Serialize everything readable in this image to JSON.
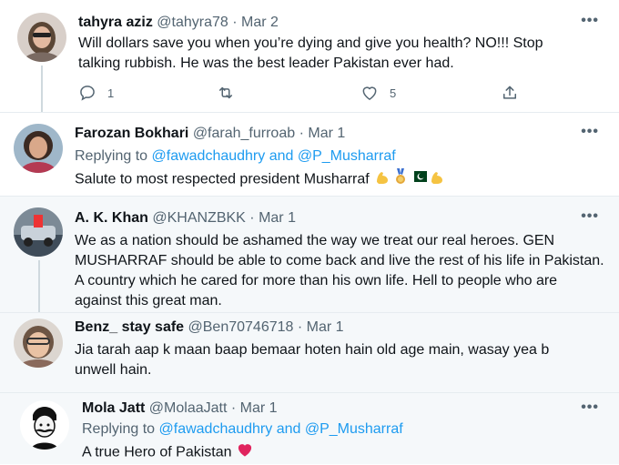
{
  "tweets": [
    {
      "name": "tahyra aziz",
      "handle": "@tahyra78",
      "date": "Mar 2",
      "text": "Will dollars save you when you’re dying and give you health? NO!!! Stop talking rubbish. He was the best leader Pakistan ever had.",
      "actions": {
        "reply_count": "1",
        "like_count": "5"
      }
    },
    {
      "name": "Farozan Bokhari",
      "handle": "@farah_furroab",
      "date": "Mar 1",
      "replying_prefix": "Replying to",
      "replying_to": "@fawadchaudhry and @P_Musharraf",
      "text": "Salute to most respected president Musharraf"
    },
    {
      "name": "A. K. Khan",
      "handle": "@KHANZBKK",
      "date": "Mar 1",
      "text": "We as a nation should be ashamed the way we treat our real heroes. GEN MUSHARRAF should be able to come back and live the rest of his life in Pakistan. A country which he cared for more than his own life. Hell to people who are against this great man."
    },
    {
      "name": "Benz_ stay safe",
      "handle": "@Ben70746718",
      "date": "Mar 1",
      "text": "Jia tarah aap k maan baap bemaar hoten hain old age main, wasay yea b unwell hain."
    },
    {
      "name": "Mola Jatt",
      "handle": "@MolaaJatt",
      "date": "Mar 1",
      "replying_prefix": "Replying to",
      "replying_to": "@fawadchaudhry and @P_Musharraf",
      "text": "A true Hero of Pakistan"
    }
  ],
  "ui": {
    "more": "•••",
    "dot": "·"
  },
  "colors": {
    "link": "#1d9bf0",
    "muted": "#536471",
    "text": "#0f1419",
    "heart": "#e0245e"
  }
}
